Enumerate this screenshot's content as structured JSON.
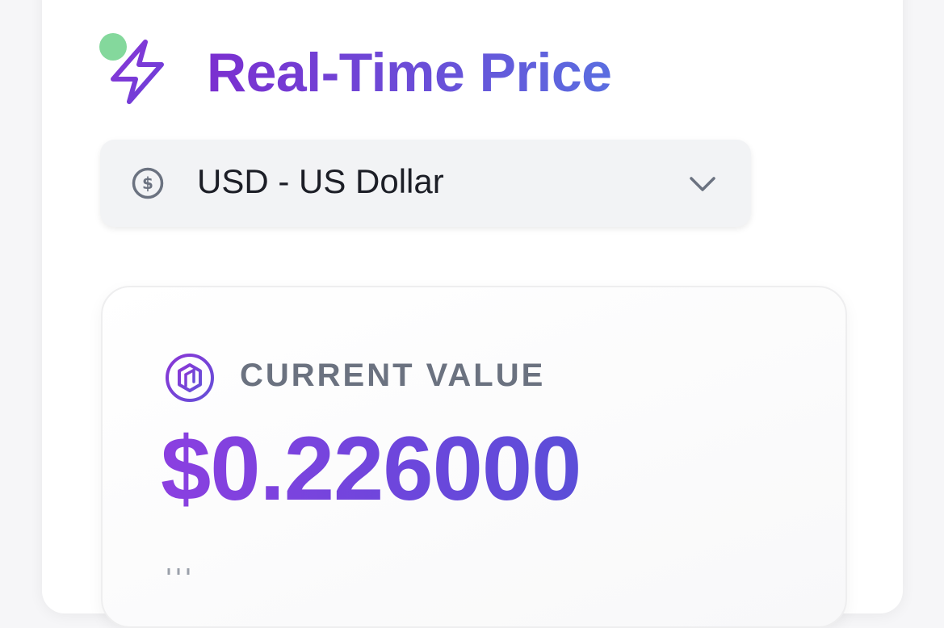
{
  "header": {
    "title": "Real-Time Price",
    "status": "online",
    "icon": "bolt-icon"
  },
  "currency_select": {
    "icon": "dollar-circle-icon",
    "selected": "USD - US Dollar",
    "chevron": "chevron-down-icon"
  },
  "value_card": {
    "icon": "coin-icon",
    "label": "CURRENT VALUE",
    "price": "$0.226000"
  },
  "colors": {
    "accent_start": "#7b2fd0",
    "accent_end": "#5a6ee0",
    "status_online": "#84d89c",
    "label_gray": "#6b7280"
  }
}
